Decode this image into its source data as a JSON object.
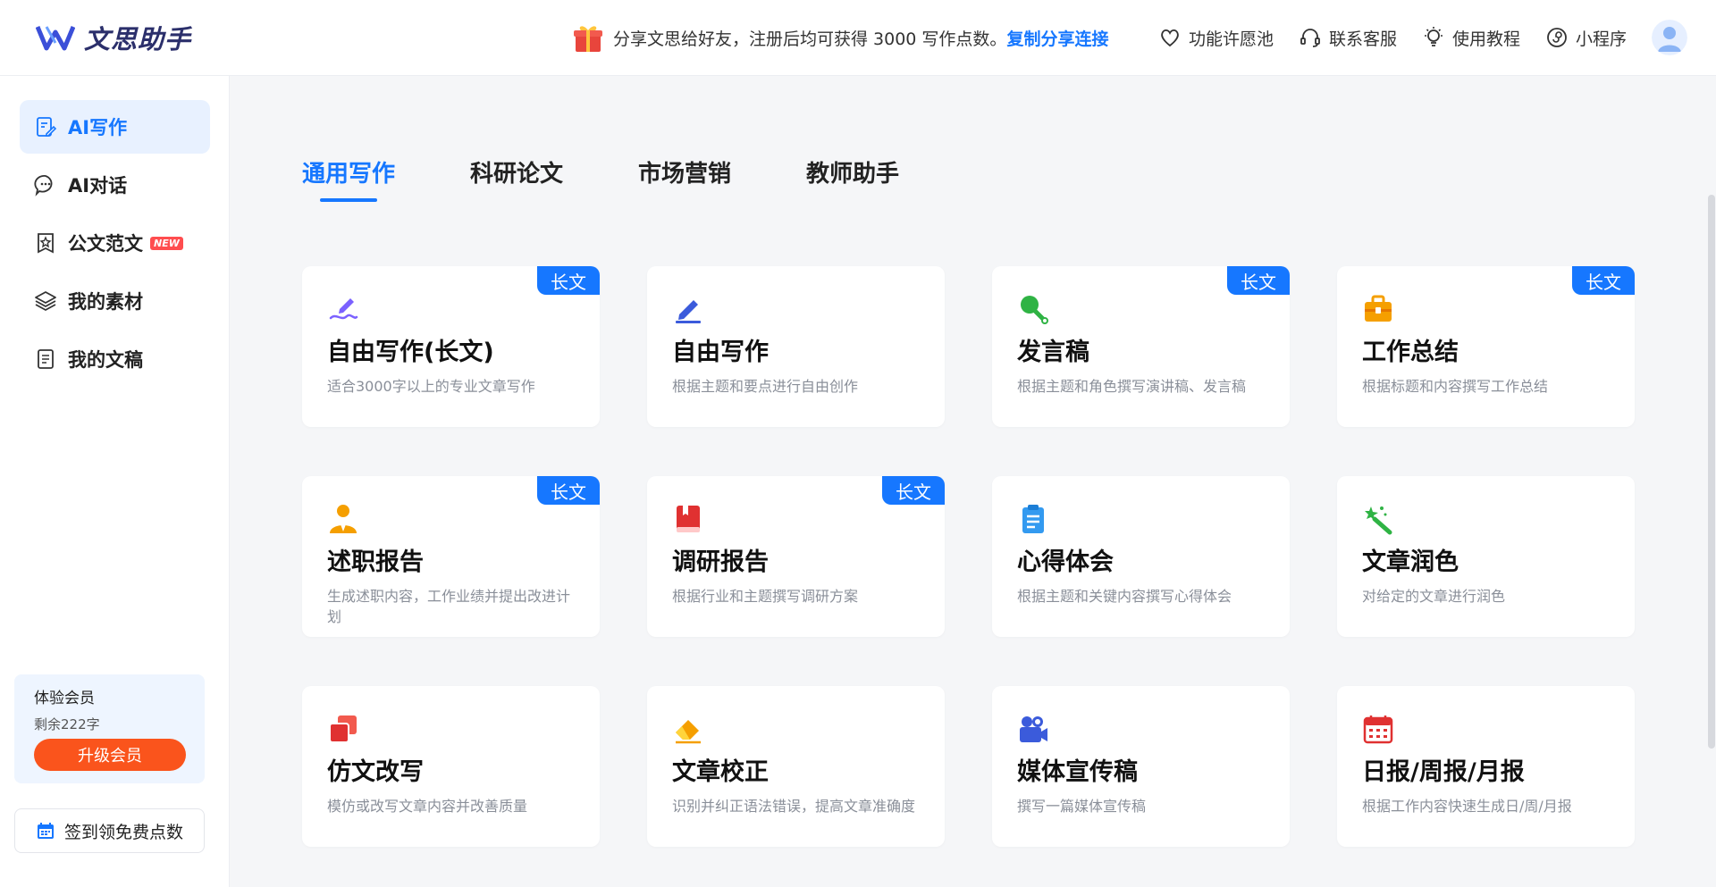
{
  "header": {
    "logo_text": "文思助手",
    "promo_text": "分享文思给好友，注册后均可获得 3000 写作点数。",
    "promo_link": "复制分享连接",
    "nav": [
      "功能许愿池",
      "联系客服",
      "使用教程",
      "小程序"
    ]
  },
  "sidebar": {
    "items": [
      {
        "label": "AI写作",
        "active": true,
        "icon": "edit-document-icon"
      },
      {
        "label": "AI对话",
        "active": false,
        "icon": "chat-bubble-icon"
      },
      {
        "label": "公文范文",
        "active": false,
        "icon": "star-badge-icon",
        "badge": "NEW"
      },
      {
        "label": "我的素材",
        "active": false,
        "icon": "layers-icon"
      },
      {
        "label": "我的文稿",
        "active": false,
        "icon": "document-icon"
      }
    ],
    "member": {
      "title": "体验会员",
      "remaining": "剩余222字",
      "upgrade_label": "升级会员"
    },
    "signin_label": "签到领免费点数"
  },
  "tabs": [
    "通用写作",
    "科研论文",
    "市场营销",
    "教师助手"
  ],
  "active_tab": 0,
  "cards": [
    {
      "title": "自由写作(长文)",
      "desc": "适合3000字以上的专业文章写作",
      "badge": "长文",
      "icon": "pen-scribble-icon"
    },
    {
      "title": "自由写作",
      "desc": "根据主题和要点进行自由创作",
      "badge": "",
      "icon": "pen-icon"
    },
    {
      "title": "发言稿",
      "desc": "根据主题和角色撰写演讲稿、发言稿",
      "badge": "长文",
      "icon": "microphone-icon"
    },
    {
      "title": "工作总结",
      "desc": "根据标题和内容撰写工作总结",
      "badge": "长文",
      "icon": "briefcase-icon"
    },
    {
      "title": "述职报告",
      "desc": "生成述职内容，工作业绩并提出改进计划",
      "badge": "长文",
      "icon": "person-tie-icon"
    },
    {
      "title": "调研报告",
      "desc": "根据行业和主题撰写调研方案",
      "badge": "长文",
      "icon": "book-icon"
    },
    {
      "title": "心得体会",
      "desc": "根据主题和关键内容撰写心得体会",
      "badge": "",
      "icon": "clipboard-icon"
    },
    {
      "title": "文章润色",
      "desc": "对给定的文章进行润色",
      "badge": "",
      "icon": "magic-wand-icon"
    },
    {
      "title": "仿文改写",
      "desc": "模仿或改写文章内容并改善质量",
      "badge": "",
      "icon": "copy-cards-icon"
    },
    {
      "title": "文章校正",
      "desc": "识别并纠正语法错误，提高文章准确度",
      "badge": "",
      "icon": "eraser-icon"
    },
    {
      "title": "媒体宣传稿",
      "desc": "撰写一篇媒体宣传稿",
      "badge": "",
      "icon": "video-camera-icon"
    },
    {
      "title": "日报/周报/月报",
      "desc": "根据工作内容快速生成日/周/月报",
      "badge": "",
      "icon": "calendar-icon"
    }
  ],
  "colors": {
    "accent": "#1677ff",
    "upgrade": "#fa541c",
    "badge_new": "#ff4d4f"
  }
}
